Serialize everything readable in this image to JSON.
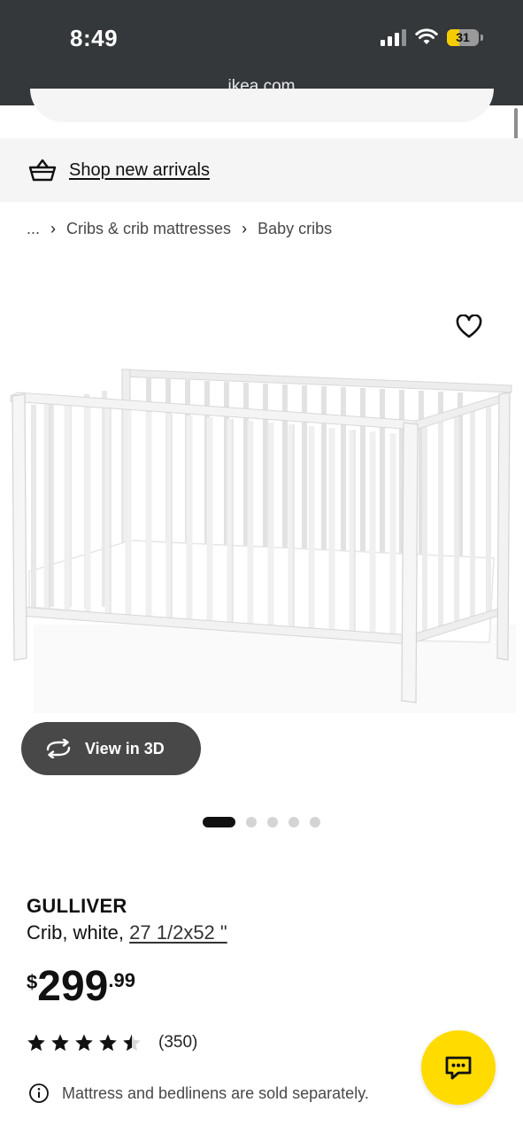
{
  "status_bar": {
    "time": "8:49",
    "battery": "31",
    "url": "ikea.com"
  },
  "promo": {
    "icon": "basket-icon",
    "link_label": "Shop new arrivals"
  },
  "breadcrumb": {
    "ellipsis": "...",
    "items": [
      "Cribs & crib mattresses",
      "Baby cribs"
    ]
  },
  "product": {
    "name": "GULLIVER",
    "description_prefix": "Crib, white, ",
    "size_link": "27 1/2x52 \"",
    "view_3d_label": "View in 3D",
    "price": {
      "currency": "$",
      "integer": "299",
      "decimal": ".99"
    },
    "rating": {
      "stars": 4.5,
      "max_stars": 5,
      "count_label": "(350)"
    },
    "notice": "Mattress and bedlinens are sold separately.",
    "gallery": {
      "total_images": 5,
      "active_index": 0
    }
  },
  "colors": {
    "status_bar": "#34383b",
    "chat_button": "#ffdb00",
    "view3d_button": "#484848"
  }
}
